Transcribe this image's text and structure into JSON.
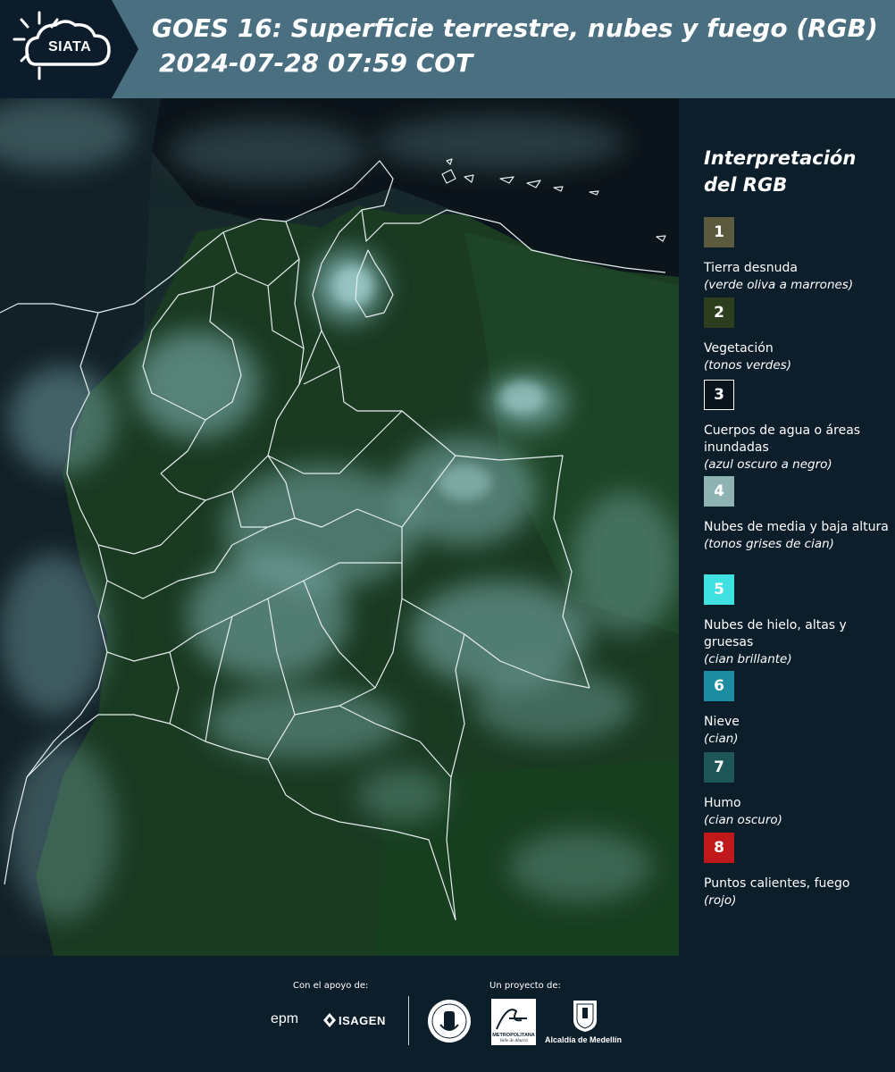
{
  "header": {
    "logo_text": "SIATA",
    "title_line1": "GOES 16: Superficie terrestre, nubes y fuego (RGB)",
    "title_line2": "2024-07-28 07:59 COT"
  },
  "legend": {
    "title": "Interpretación del RGB",
    "items": [
      {
        "num": "1",
        "color": "#5b5a3f",
        "text_color": "#ffffff",
        "label": "Tierra desnuda",
        "sub": "(verde oliva a marrones)"
      },
      {
        "num": "2",
        "color": "#2d3e1f",
        "text_color": "#ffffff",
        "label": "Vegetación",
        "sub": "(tonos verdes)"
      },
      {
        "num": "3",
        "color": "#0a141c",
        "text_color": "#ffffff",
        "label": "Cuerpos de agua o áreas inundadas",
        "sub": "(azul oscuro a negro)"
      },
      {
        "num": "4",
        "color": "#8fb2b2",
        "text_color": "#ffffff",
        "label": "Nubes de media y baja altura",
        "sub": "(tonos grises de cian)"
      },
      {
        "num": "5",
        "color": "#3ee0e0",
        "text_color": "#ffffff",
        "label": "Nubes de hielo, altas y gruesas",
        "sub": "(cian brillante)"
      },
      {
        "num": "6",
        "color": "#1d8ba0",
        "text_color": "#ffffff",
        "label": "Nieve",
        "sub": "(cian)"
      },
      {
        "num": "7",
        "color": "#1e5557",
        "text_color": "#ffffff",
        "label": "Humo",
        "sub": "(cian oscuro)"
      },
      {
        "num": "8",
        "color": "#c0191c",
        "text_color": "#ffffff",
        "label": "Puntos calientes, fuego",
        "sub": "(rojo)"
      }
    ]
  },
  "footer": {
    "support_label": "Con el apoyo de:",
    "project_label": "Un proyecto de:",
    "sponsor_epm": "epm",
    "sponsor_isagen": "ISAGEN",
    "logo_metro_name": "METROPOLITANA",
    "logo_metro_sub": "Valle de Aburrá",
    "logo_alcaldia": "Alcaldía de Medellín"
  }
}
